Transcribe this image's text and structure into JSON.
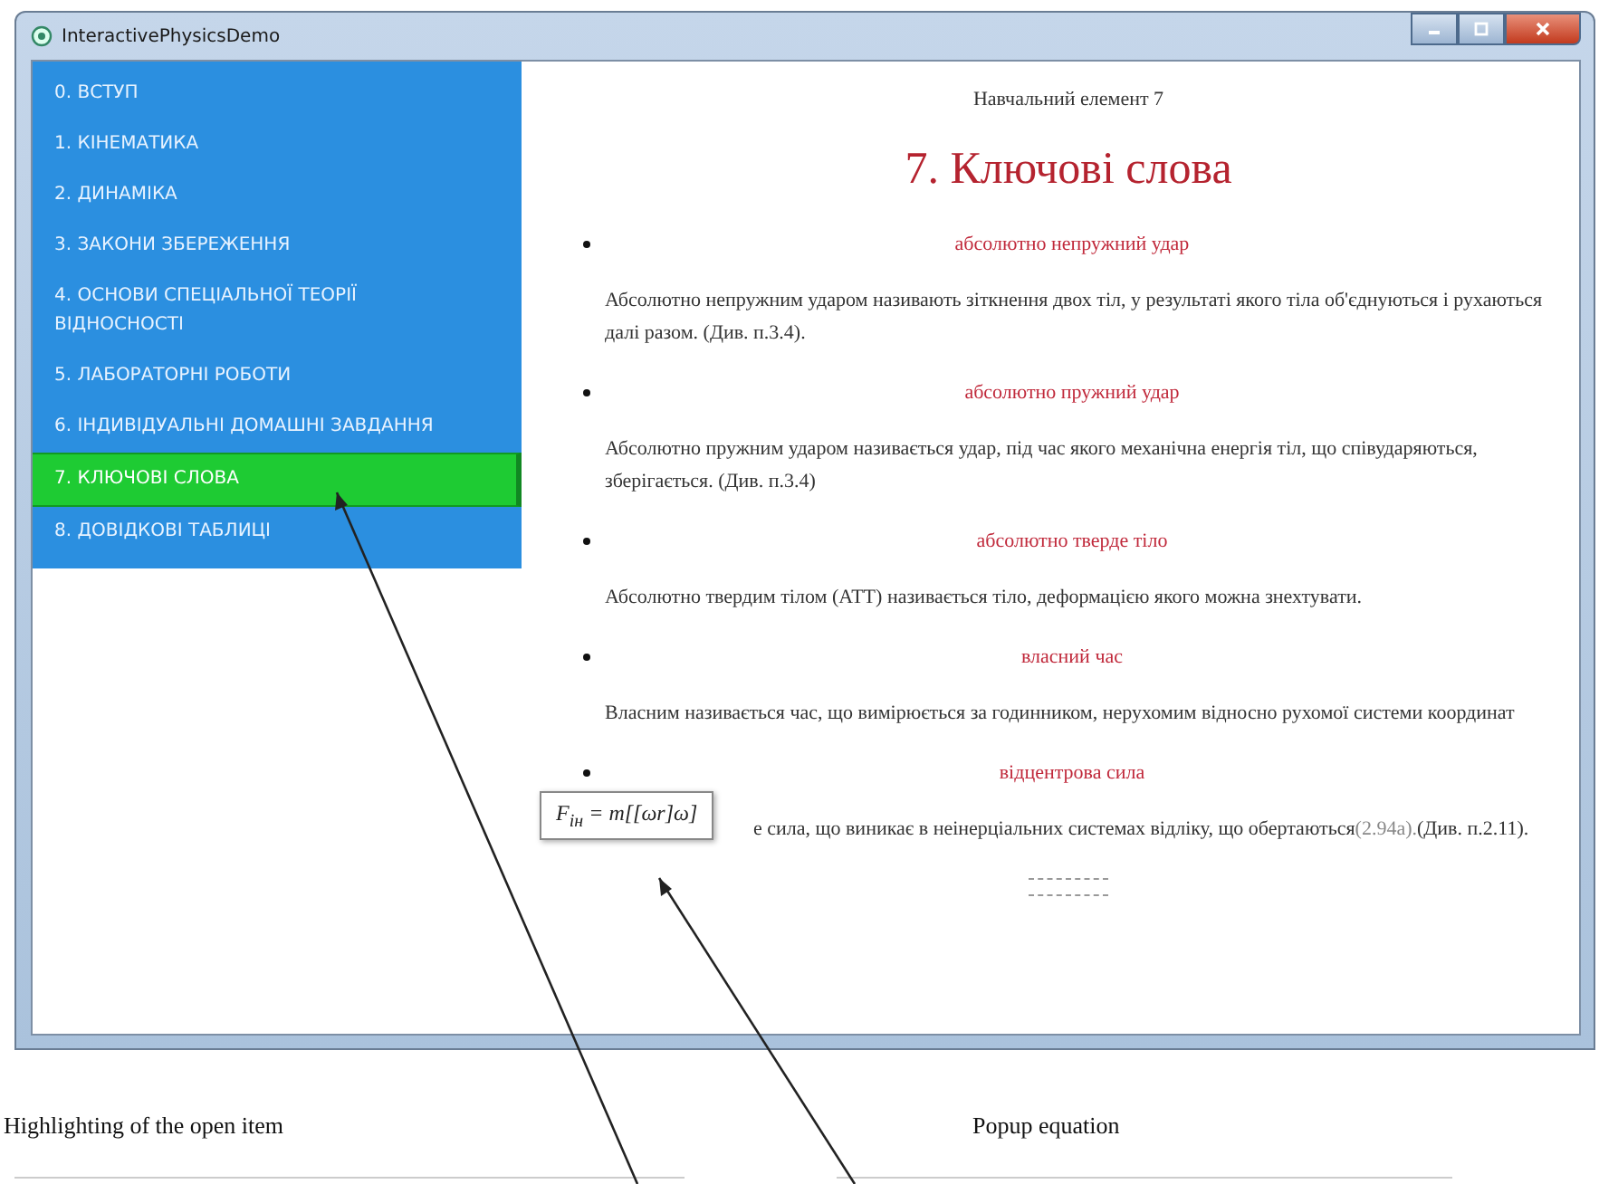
{
  "window": {
    "title": "InteractivePhysicsDemo"
  },
  "sidebar": {
    "items": [
      {
        "label": "0. ВСТУП",
        "selected": false
      },
      {
        "label": "1. КІНЕМАТИКА",
        "selected": false
      },
      {
        "label": "2. ДИНАМІКА",
        "selected": false
      },
      {
        "label": "3. ЗАКОНИ ЗБЕРЕЖЕННЯ",
        "selected": false
      },
      {
        "label": "4. ОСНОВИ СПЕЦІАЛЬНОЇ ТЕОРІЇ ВІДНОСНОСТІ",
        "selected": false
      },
      {
        "label": "5. ЛАБОРАТОРНІ РОБОТИ",
        "selected": false
      },
      {
        "label": "6. ІНДИВІДУАЛЬНІ ДОМАШНІ ЗАВДАННЯ",
        "selected": false
      },
      {
        "label": "7. КЛЮЧОВІ СЛОВА",
        "selected": true
      },
      {
        "label": "8. ДОВІДКОВІ ТАБЛИЦІ",
        "selected": false
      }
    ]
  },
  "content": {
    "subtitle": "Навчальний елемент 7",
    "heading": "7. Ключові слова",
    "definitions": [
      {
        "term": "абсолютно непружний удар",
        "text": "Абсолютно непружним ударом називають зіткнення двох тіл, у результаті якого тіла об'єднуються і рухаються далі разом. (Див. п.3.4)."
      },
      {
        "term": "абсолютно пружний удар",
        "text": "Абсолютно пружним ударом називається удар, під час якого механічна енергія тіл, що співударяються, зберігається. (Див. п.3.4)"
      },
      {
        "term": "абсолютно тверде тіло",
        "text": "Абсолютно твердим тілом (АТТ) називається тіло, деформацією якого можна знехтувати."
      },
      {
        "term": "власний час",
        "text": "Власним називається час, що вимірюється за годинником, нерухомим відносно рухомої системи координат"
      },
      {
        "term": "відцентрова сила",
        "text": "е сила, що виникає в неінерціальних системах відліку, що обертаються",
        "ref": "(2.94а).",
        "tail": "(Див. п.2.11).",
        "popup": "F$_{ін}$ = m[[ωr]ω]"
      }
    ]
  },
  "annotations": [
    "Highlighting  of the open item",
    "Popup equation"
  ]
}
